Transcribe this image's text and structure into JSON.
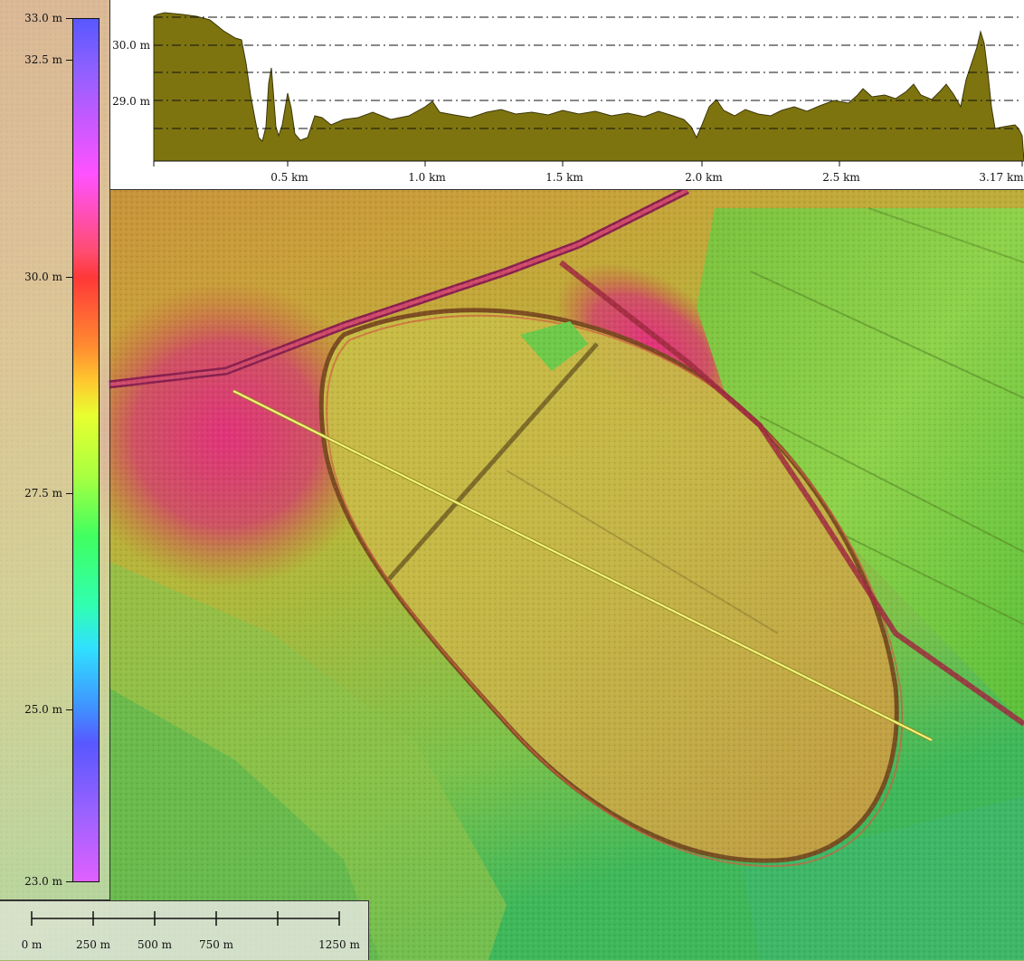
{
  "legend": {
    "labels": [
      "33.0 m",
      "32.5 m",
      "30.0 m",
      "27.5 m",
      "25.0 m",
      "23.0 m"
    ]
  },
  "profile": {
    "fill_color": "#7d7410",
    "x_labels": [
      "0.5 km",
      "1.0 km",
      "1.5 km",
      "2.0 km",
      "2.5 km",
      "3.17 km"
    ],
    "y_labels": [
      "30.0 m",
      "29.0 m"
    ]
  },
  "scale_bar": {
    "labels": [
      "0 m",
      "250 m",
      "500 m",
      "750 m",
      "1250 m"
    ]
  },
  "map": {
    "profile_line_color": "#f5f07a"
  }
}
